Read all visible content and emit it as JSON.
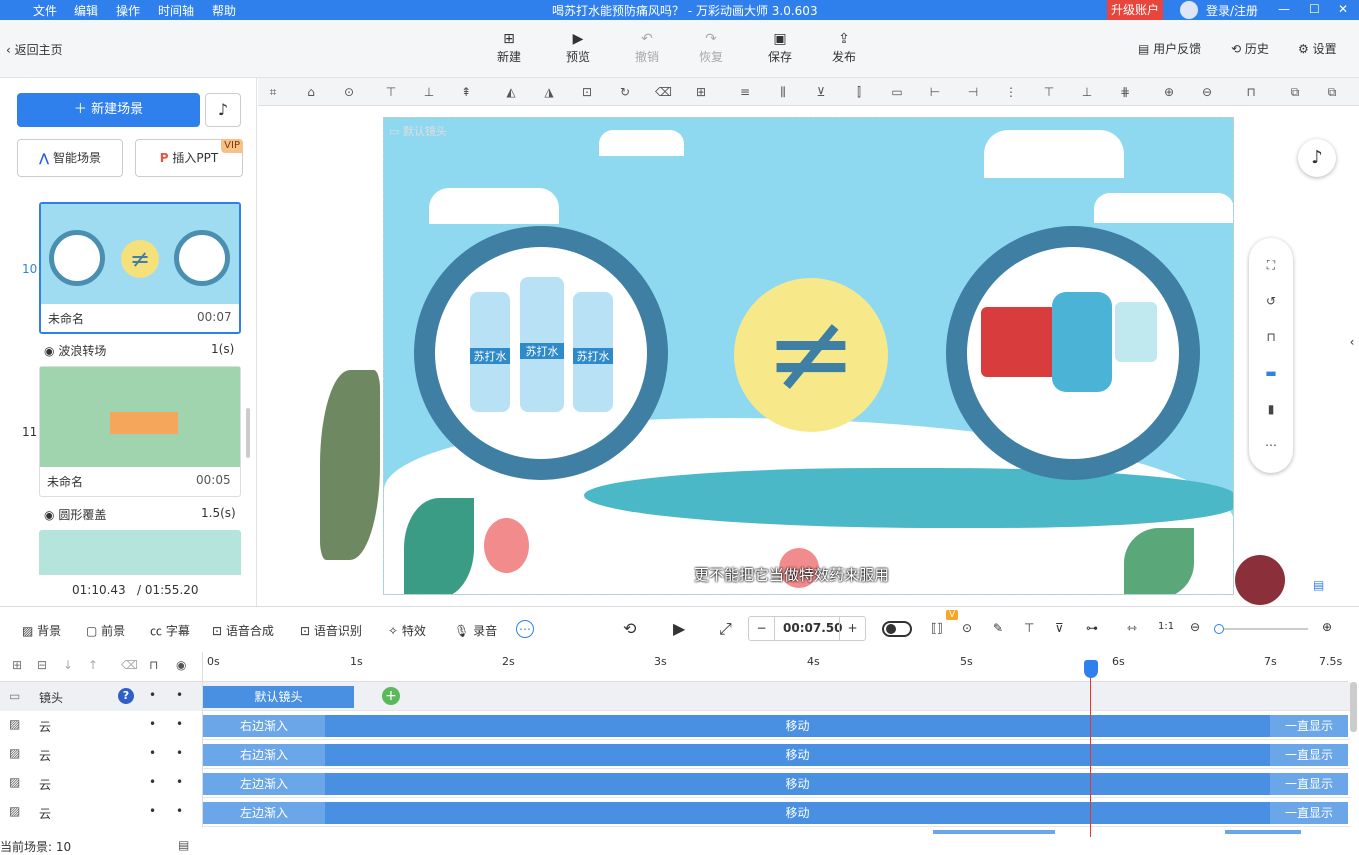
{
  "menubar": {
    "items": [
      "文件",
      "编辑",
      "操作",
      "时间轴",
      "帮助"
    ],
    "title": "喝苏打水能预防痛风吗？ - 万彩动画大师 3.0.603",
    "upgrade": "升级账户",
    "login": "登录/注册"
  },
  "toolbar": {
    "back": "返回主页",
    "buttons": [
      {
        "label": "新建",
        "icon": "plus-square-icon"
      },
      {
        "label": "预览",
        "icon": "play-icon"
      },
      {
        "label": "撤销",
        "icon": "undo-icon"
      },
      {
        "label": "恢复",
        "icon": "redo-icon"
      },
      {
        "label": "保存",
        "icon": "save-icon"
      },
      {
        "label": "发布",
        "icon": "publish-icon"
      }
    ],
    "feedback": "用户反馈",
    "history": "历史",
    "settings": "设置"
  },
  "left": {
    "new_scene": "新建场景",
    "smart_scene": "智能场景",
    "insert_ppt": "插入PPT",
    "vip": "VIP",
    "scenes": [
      {
        "num": "10",
        "name": "未命名",
        "duration": "00:07"
      },
      {
        "num": "11",
        "name": "未命名",
        "duration": "00:05"
      }
    ],
    "transitions": [
      {
        "name": "波浪转场",
        "duration": "1(s)"
      },
      {
        "name": "圆形覆盖",
        "duration": "1.5(s)"
      }
    ],
    "time_current": "01:10.43",
    "time_total": "/ 01:55.20"
  },
  "stage": {
    "camera_label": "默认镜头",
    "bottle_label": "苏打水",
    "subtitle": "更不能把它当做特效药来服用"
  },
  "ctrl": {
    "items": [
      "背景",
      "前景",
      "字幕",
      "语音合成",
      "语音识别",
      "特效",
      "录音"
    ],
    "time": "00:07.50",
    "v_badge": "V"
  },
  "timeline": {
    "ticks": [
      "0s",
      "1s",
      "2s",
      "3s",
      "4s",
      "5s",
      "6s",
      "7s",
      "7.5s"
    ],
    "camera_row": {
      "label": "镜头",
      "block": "默认镜头",
      "help": "?"
    },
    "rows": [
      {
        "label": "云",
        "enter": "右边渐入",
        "move": "移动",
        "keep": "一直显示"
      },
      {
        "label": "云",
        "enter": "右边渐入",
        "move": "移动",
        "keep": "一直显示"
      },
      {
        "label": "云",
        "enter": "左边渐入",
        "move": "移动",
        "keep": "一直显示"
      },
      {
        "label": "云",
        "enter": "左边渐入",
        "move": "移动",
        "keep": "一直显示"
      }
    ],
    "status": "当前场景: 10"
  },
  "colors": {
    "accent": "#2f80ed",
    "bar": "#4a90e2",
    "danger": "#e8453c"
  }
}
